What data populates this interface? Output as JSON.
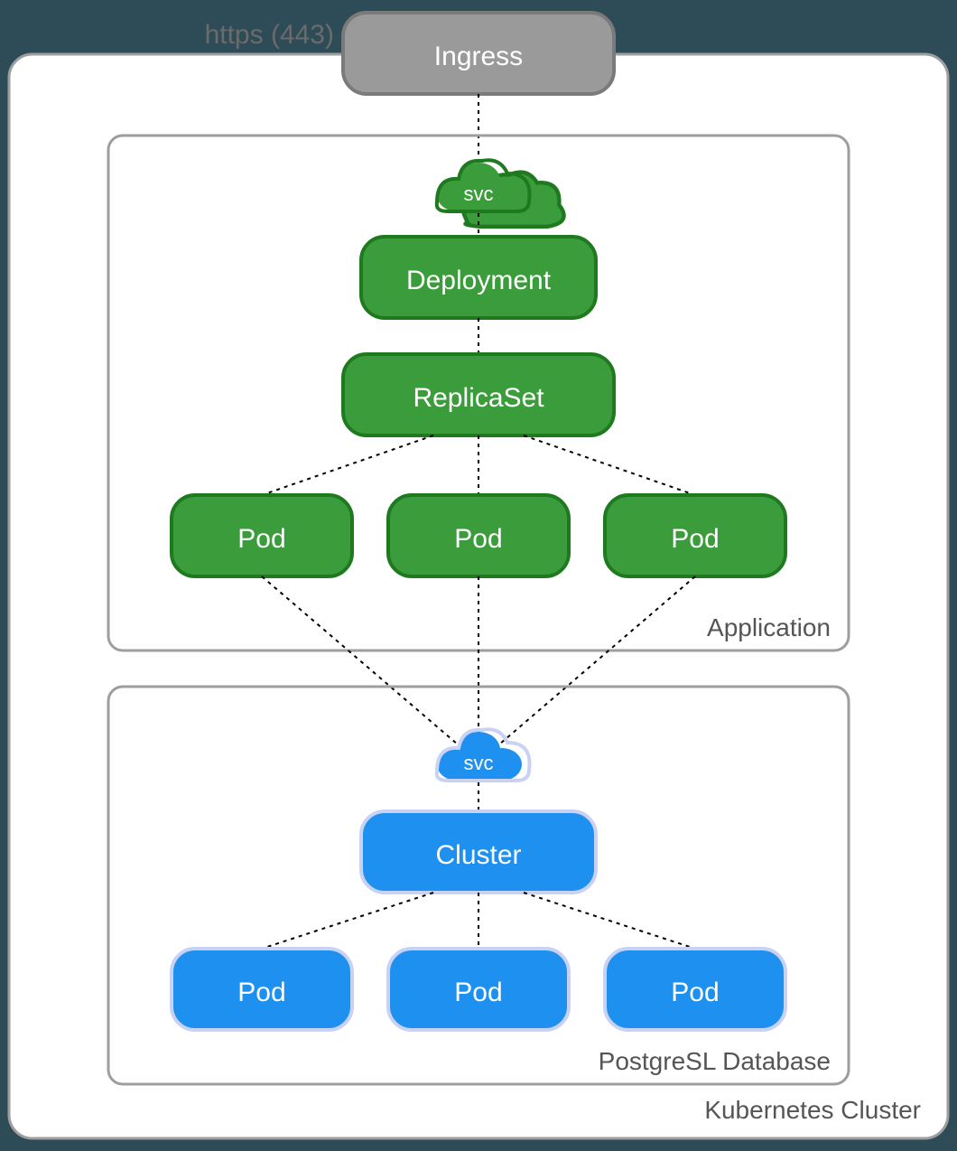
{
  "protocol_label": "https (443)",
  "outer_box_label": "Kubernetes Cluster",
  "ingress": {
    "label": "Ingress"
  },
  "app_box": {
    "label": "Application",
    "svc": "svc",
    "deployment": "Deployment",
    "replicaset": "ReplicaSet",
    "pods": [
      "Pod",
      "Pod",
      "Pod"
    ]
  },
  "db_box": {
    "label": "PostgreSL Database",
    "svc": "svc",
    "cluster": "Cluster",
    "pods": [
      "Pod",
      "Pod",
      "Pod"
    ]
  },
  "colors": {
    "ingress_fill": "#9a9a9a",
    "ingress_stroke": "#7a7a7a",
    "green_fill": "#3a9c3a",
    "green_stroke": "#1f7a1f",
    "blue_fill": "#1e90ef",
    "blue_stroke": "#c9d2f3",
    "box_stroke": "#9e9e9e",
    "bg": "#ffffff"
  }
}
